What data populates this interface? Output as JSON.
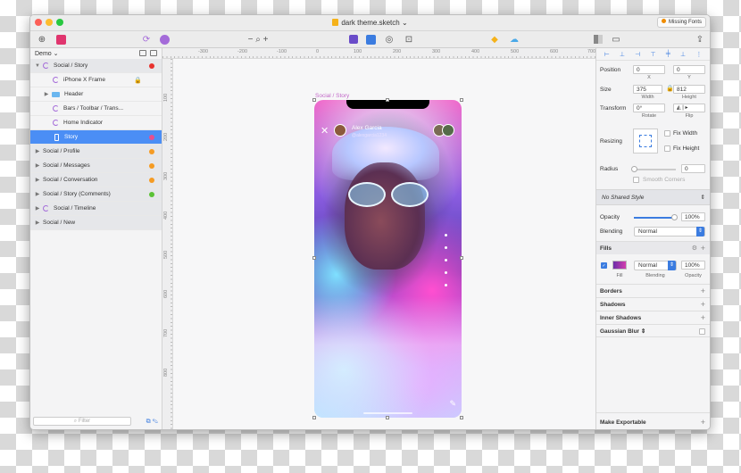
{
  "window": {
    "title": "dark theme.sketch",
    "missing_fonts": "Missing Fonts"
  },
  "layers_panel": {
    "page": "Demo",
    "items": [
      {
        "label": "Social / Story",
        "dot": "#e8322e"
      },
      {
        "label": "iPhone X Frame"
      },
      {
        "label": "Header"
      },
      {
        "label": "Bars / Toolbar / Trans..."
      },
      {
        "label": "Home Indicator"
      },
      {
        "label": "Story",
        "dot": "#e84e8e"
      },
      {
        "label": "Social / Profile",
        "dot": "#f59b23"
      },
      {
        "label": "Social / Messages",
        "dot": "#f59b23"
      },
      {
        "label": "Social / Conversation",
        "dot": "#f59b23"
      },
      {
        "label": "Social / Story (Comments)",
        "dot": "#5bc236"
      },
      {
        "label": "Social / Timeline"
      },
      {
        "label": "Social / New"
      }
    ],
    "filter_placeholder": "Filter"
  },
  "canvas": {
    "ruler_top": [
      "-300",
      "-200",
      "-100",
      "0",
      "100",
      "200",
      "300",
      "400",
      "500",
      "600",
      "700"
    ],
    "ruler_left": [
      "100",
      "200",
      "300",
      "400",
      "500",
      "600",
      "700",
      "800"
    ],
    "artboard_label": "Social / Story",
    "story": {
      "name": "Alex Garcia",
      "handle": "@alexgarcia1234"
    }
  },
  "inspector": {
    "position_label": "Position",
    "x": "0",
    "y": "0",
    "x_cap": "X",
    "y_cap": "Y",
    "size_label": "Size",
    "width": "375",
    "height": "812",
    "width_cap": "Width",
    "height_cap": "Height",
    "transform_label": "Transform",
    "rotate": "0°",
    "rotate_cap": "Rotate",
    "flip_cap": "Flip",
    "resizing_label": "Resizing",
    "fix_width": "Fix Width",
    "fix_height": "Fix Height",
    "radius_label": "Radius",
    "radius": "0",
    "smooth_corners": "Smooth Corners",
    "shared_style": "No Shared Style",
    "opacity_label": "Opacity",
    "opacity": "100%",
    "blending_label": "Blending",
    "blending": "Normal",
    "fills_label": "Fills",
    "fill_blend": "Normal",
    "fill_opacity": "100%",
    "fill_cap": "Fill",
    "blending_cap": "Blending",
    "opacity_cap": "Opacity",
    "borders": "Borders",
    "shadows": "Shadows",
    "inner_shadows": "Inner Shadows",
    "gaussian_blur": "Gaussian Blur",
    "make_exportable": "Make Exportable"
  },
  "colors": {
    "accent": "#3b7ce0",
    "symbol": "#a46bd9",
    "selection": "#4b8ef5"
  }
}
